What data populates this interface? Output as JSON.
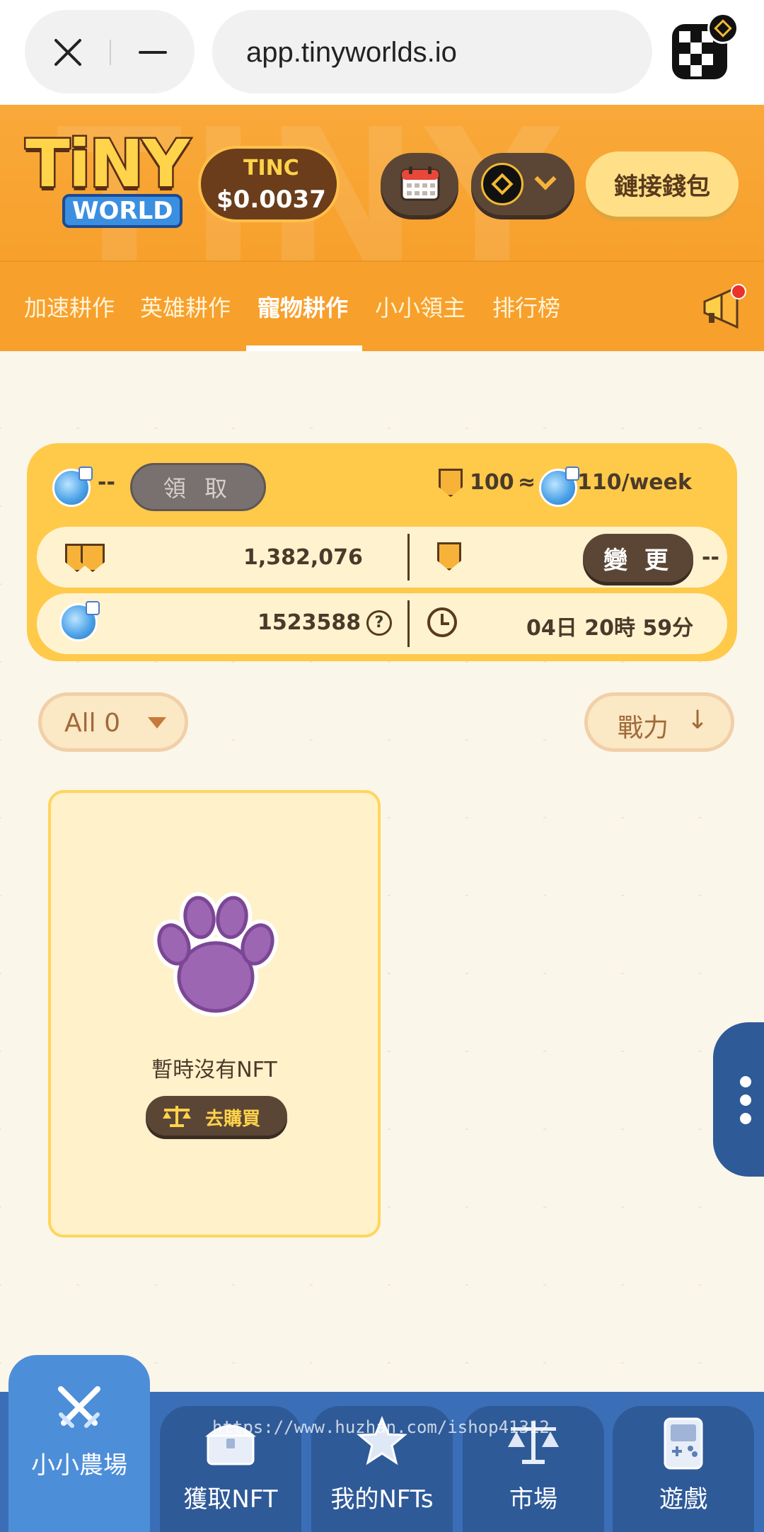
{
  "browser": {
    "url": "app.tinyworlds.io"
  },
  "header": {
    "logo_text": "TiNY",
    "logo_sub": "WORLD",
    "token_label": "TINC",
    "token_price": "$0.0037",
    "connect_wallet": "鏈接錢包"
  },
  "nav": {
    "tabs": [
      {
        "label": "加速耕作"
      },
      {
        "label": "英雄耕作"
      },
      {
        "label": "寵物耕作",
        "active": true
      },
      {
        "label": "小小領主"
      },
      {
        "label": "排行榜"
      }
    ]
  },
  "stats": {
    "pending": "--",
    "claim_label": "領 取",
    "power_per": "100",
    "approx": "≈",
    "reward_rate": "110/week",
    "total_power": "1,382,076",
    "my_power": "--",
    "change_label": "變 更",
    "pool_amount": "1523588",
    "help": "?",
    "countdown": "04日 20時 59分"
  },
  "filters": {
    "filter_label": "All 0",
    "sort_label": "戰力",
    "sort_arrow": "↓"
  },
  "empty": {
    "message": "暫時沒有NFT",
    "buy_label": "去購買"
  },
  "bottom_nav": {
    "items": [
      {
        "label": "小小農場",
        "active": true
      },
      {
        "label": "獲取NFT"
      },
      {
        "label": "我的NFTs"
      },
      {
        "label": "市場"
      },
      {
        "label": "遊戲"
      }
    ]
  },
  "watermark": "https://www.huzhan.com/ishop41312",
  "colors": {
    "header_orange": "#f7a02c",
    "card_yellow": "#ffc94a",
    "dark_button": "#5b4636",
    "bottom_blue": "#2f5a98",
    "active_blue": "#4d8ed8",
    "paw_purple": "#9c66b3"
  }
}
